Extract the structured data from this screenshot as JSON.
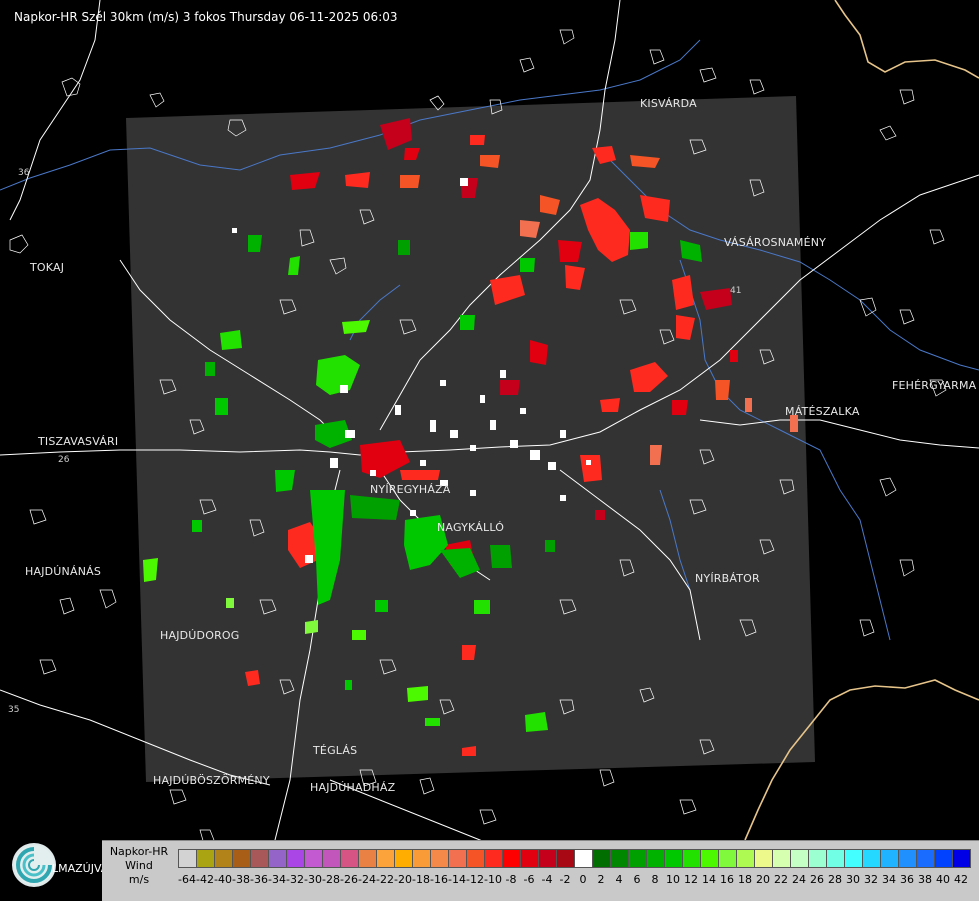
{
  "header": {
    "title": "Napkor-HR Szél 30km (m/s) 3 fokos Thursday 06-11-2025 06:03"
  },
  "cities": [
    {
      "id": "kisvarda",
      "name": "KISVÁRDA"
    },
    {
      "id": "vasarosnameny",
      "name": "VÁSÁROSNAMÉNY"
    },
    {
      "id": "tokaj",
      "name": "TOKAJ"
    },
    {
      "id": "fehergyarmat",
      "name": "FEHÉRGYARMA"
    },
    {
      "id": "mateszalka",
      "name": "MÁTÉSZALKA"
    },
    {
      "id": "tiszavasvari",
      "name": "TISZAVASVÁRI"
    },
    {
      "id": "nyiregyhaza",
      "name": "NYÍREGYHÁZA"
    },
    {
      "id": "nagykallo",
      "name": "NAGYKÁLLÓ"
    },
    {
      "id": "hajdunanas",
      "name": "HAJDÚNÁNÁS"
    },
    {
      "id": "nyirbator",
      "name": "NYÍRBÁTOR"
    },
    {
      "id": "hajdudorog",
      "name": "HAJDÚDOROG"
    },
    {
      "id": "teglas",
      "name": "TÉGLÁS"
    },
    {
      "id": "hajduboszormeny",
      "name": "HAJDÚBÖSZÖRMÉNY"
    },
    {
      "id": "hajduhadhaz",
      "name": "HAJDÚHADHÁZ"
    }
  ],
  "road_labels": [
    "41",
    "36",
    "35",
    "26"
  ],
  "logo": {
    "text": "LMAZÚJVÁR"
  },
  "legend": {
    "title_line1": "Napkor-HR",
    "title_line2": "Wind",
    "unit": "m/s",
    "ticks": [
      "-64",
      "-42",
      "-40",
      "-38",
      "-36",
      "-34",
      "-32",
      "-30",
      "-28",
      "-26",
      "-24",
      "-22",
      "-20",
      "-18",
      "-16",
      "-14",
      "-12",
      "-10",
      "-8",
      "-6",
      "-4",
      "-2",
      "0",
      "2",
      "4",
      "6",
      "8",
      "10",
      "12",
      "14",
      "16",
      "18",
      "20",
      "22",
      "24",
      "26",
      "28",
      "30",
      "32",
      "34",
      "36",
      "38",
      "40",
      "42"
    ],
    "colors": [
      "#d3d3d3",
      "#aaa412",
      "#b28318",
      "#a85e17",
      "#a85858",
      "#9464c8",
      "#aa46e6",
      "#c45ad2",
      "#c256ba",
      "#d65484",
      "#e98044",
      "#fca33b",
      "#ffae00",
      "#f99b36",
      "#f5894a",
      "#f27050",
      "#f55426",
      "#ff2a1f",
      "#fe0000",
      "#e00010",
      "#c4001a",
      "#a80814",
      "#ffffff",
      "#006e00",
      "#008700",
      "#00a000",
      "#00b200",
      "#00c800",
      "#22e000",
      "#4cf900",
      "#80f93c",
      "#aef952",
      "#edf98a",
      "#d7ffb0",
      "#c5ffc5",
      "#9cffd2",
      "#71ffe5",
      "#43ffff",
      "#24d8ff",
      "#20b3ff",
      "#2090ff",
      "#1a6bff",
      "#0042ff",
      "#0000e6"
    ]
  }
}
